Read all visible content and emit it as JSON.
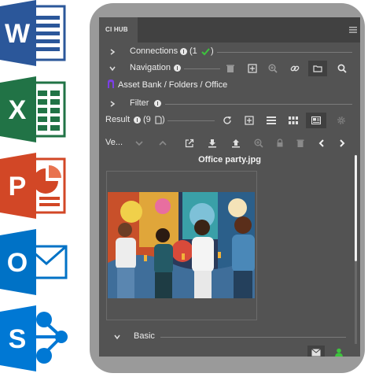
{
  "apps": [
    {
      "name": "Word",
      "letter": "W",
      "color": "#2b579a"
    },
    {
      "name": "Excel",
      "letter": "X",
      "color": "#217346"
    },
    {
      "name": "PowerPoint",
      "letter": "P",
      "color": "#d24726"
    },
    {
      "name": "Outlook",
      "letter": "O",
      "color": "#0072c6"
    },
    {
      "name": "SharePoint",
      "letter": "S",
      "color": "#0078d4"
    }
  ],
  "panel": {
    "tab_label": "CI HUB",
    "connections": {
      "label": "Connections",
      "count": "(1"
    },
    "navigation": {
      "label": "Navigation"
    },
    "breadcrumb": "Asset Bank / Folders / Office",
    "filter": {
      "label": "Filter"
    },
    "result": {
      "label": "Result",
      "count": "(9"
    },
    "view_label": "Ve...",
    "file_name": "Office party.jpg",
    "basic": {
      "label": "Basic"
    }
  },
  "colors": {
    "accent_green": "#3dc43d",
    "panel_bg": "#535353",
    "frame": "#9a9a9a"
  }
}
